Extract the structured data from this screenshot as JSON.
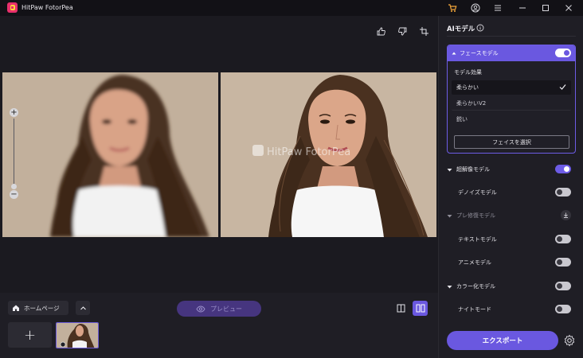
{
  "app": {
    "title": "HitPaw FotorPea"
  },
  "titlebar": {
    "icons": [
      "cart-icon",
      "account-icon",
      "menu-icon",
      "minimize-icon",
      "maximize-icon",
      "close-icon"
    ]
  },
  "canvas": {
    "watermark": "HitPaw FotorPea",
    "tools": [
      "thumbs-up-icon",
      "thumbs-down-icon",
      "crop-icon"
    ],
    "zoom": {
      "plus": "+",
      "minus": "−"
    }
  },
  "bottom": {
    "home_label": "ホームページ",
    "preview_label": "プレビュー",
    "add_label": "+"
  },
  "panel": {
    "title": "AIモデル",
    "face_model": {
      "label": "フェースモデル",
      "enabled": true,
      "effect_title": "モデル効果",
      "options": [
        "柔らかい",
        "柔らかいV2",
        "鋭い"
      ],
      "selected": "柔らかい",
      "select_button": "フェイスを選択"
    },
    "models": [
      {
        "label": "超解像モデル",
        "toggle": "on"
      },
      {
        "label": "デノイズモデル",
        "toggle": "off"
      },
      {
        "label": "プレ修復モデル",
        "toggle": "download"
      },
      {
        "label": "テキストモデル",
        "toggle": "off"
      },
      {
        "label": "アニメモデル",
        "toggle": "off"
      },
      {
        "label": "カラー化モデル",
        "toggle": "off"
      },
      {
        "label": "ナイトモード",
        "toggle": "off"
      }
    ],
    "export_label": "エクスポート"
  },
  "colors": {
    "accent": "#6a58e0",
    "background": "#17161c",
    "panel": "#1f1e25"
  }
}
